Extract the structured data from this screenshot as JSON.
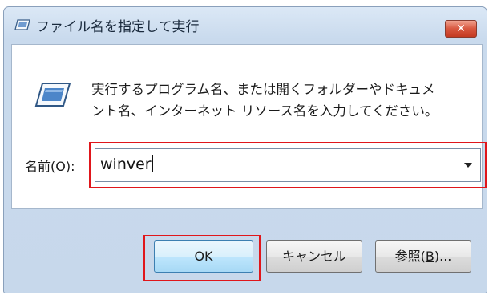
{
  "window": {
    "title": "ファイル名を指定して実行",
    "close_glyph": "✕"
  },
  "dialog": {
    "description_line1": "実行するプログラム名、または開くフォルダーやドキュメ",
    "description_line2": "ント名、インターネット リソース名を入力してください。",
    "name_label_prefix": "名前(",
    "name_label_accel": "O",
    "name_label_suffix": "):",
    "input_value": "winver"
  },
  "buttons": {
    "ok": "OK",
    "cancel": "キャンセル",
    "browse_prefix": "参照(",
    "browse_accel": "B",
    "browse_suffix": ")..."
  },
  "icons": {
    "title": "run-dialog-icon",
    "main": "run-program-icon",
    "dropdown": "chevron-down-icon"
  },
  "colors": {
    "highlight": "#e0161b",
    "close_button": "#c43a21",
    "window_frame": "#c9daed"
  }
}
